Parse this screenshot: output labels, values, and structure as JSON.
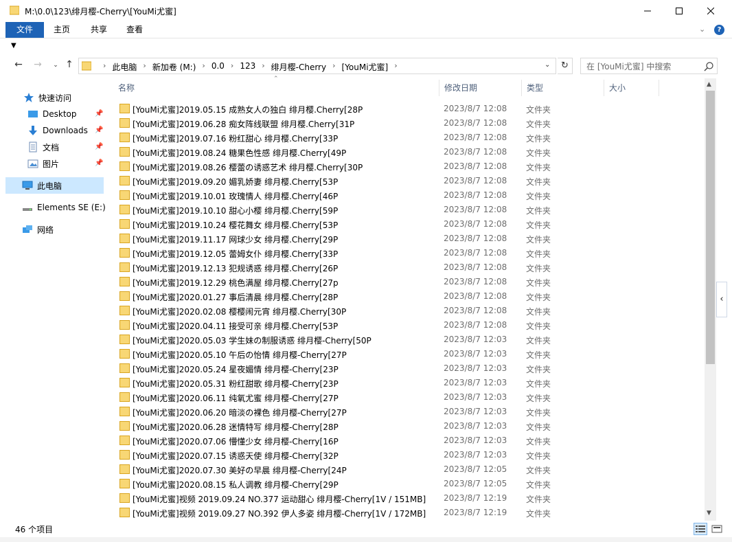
{
  "window": {
    "title": "M:\\0.0\\123\\绯月樱-Cherry\\[YouMi尤蜜]"
  },
  "ribbon": {
    "tabs": [
      "文件",
      "主页",
      "共享",
      "查看"
    ],
    "help_label": "?"
  },
  "address": {
    "crumbs": [
      "此电脑",
      "新加卷 (M:)",
      "0.0",
      "123",
      "绯月樱-Cherry",
      "[YouMi尤蜜]"
    ]
  },
  "search": {
    "placeholder": "在 [YouMi尤蜜] 中搜索"
  },
  "sidebar": {
    "items": [
      {
        "label": "快速访问",
        "icon": "star-icon"
      },
      {
        "label": "Desktop",
        "icon": "desktop-icon",
        "pinned": true
      },
      {
        "label": "Downloads",
        "icon": "download-icon",
        "pinned": true
      },
      {
        "label": "文档",
        "icon": "document-icon",
        "pinned": true
      },
      {
        "label": "图片",
        "icon": "picture-icon",
        "pinned": true
      },
      {
        "label": "此电脑",
        "icon": "computer-icon",
        "selected": true
      },
      {
        "label": "Elements SE (E:)",
        "icon": "drive-icon"
      },
      {
        "label": "网络",
        "icon": "network-icon"
      }
    ]
  },
  "columns": {
    "name": "名称",
    "date": "修改日期",
    "type": "类型",
    "size": "大小"
  },
  "files": [
    {
      "name": "[YouMi尤蜜]2019.05.15 成熟女人の独白 绯月樱.Cherry[28P",
      "date": "2023/8/7 12:08",
      "type": "文件夹"
    },
    {
      "name": "[YouMi尤蜜]2019.06.28 痴女阵线联盟 绯月樱.Cherry[31P",
      "date": "2023/8/7 12:08",
      "type": "文件夹"
    },
    {
      "name": "[YouMi尤蜜]2019.07.16 粉红甜心 绯月樱.Cherry[33P",
      "date": "2023/8/7 12:08",
      "type": "文件夹"
    },
    {
      "name": "[YouMi尤蜜]2019.08.24 糖果色性感 绯月樱.Cherry[49P",
      "date": "2023/8/7 12:08",
      "type": "文件夹"
    },
    {
      "name": "[YouMi尤蜜]2019.08.26 樱蕾の诱惑艺术 绯月樱.Cherry[30P",
      "date": "2023/8/7 12:08",
      "type": "文件夹"
    },
    {
      "name": "[YouMi尤蜜]2019.09.20 媚乳娇妻 绯月樱.Cherry[53P",
      "date": "2023/8/7 12:08",
      "type": "文件夹"
    },
    {
      "name": "[YouMi尤蜜]2019.10.01 玫瑰情人 绯月樱.Cherry[46P",
      "date": "2023/8/7 12:08",
      "type": "文件夹"
    },
    {
      "name": "[YouMi尤蜜]2019.10.10 甜心小樱 绯月樱.Cherry[59P",
      "date": "2023/8/7 12:08",
      "type": "文件夹"
    },
    {
      "name": "[YouMi尤蜜]2019.10.24 樱花舞女 绯月樱.Cherry[53P",
      "date": "2023/8/7 12:08",
      "type": "文件夹"
    },
    {
      "name": "[YouMi尤蜜]2019.11.17 网球少女 绯月樱.Cherry[29P",
      "date": "2023/8/7 12:08",
      "type": "文件夹"
    },
    {
      "name": "[YouMi尤蜜]2019.12.05 蕾姆女仆 绯月樱.Cherry[33P",
      "date": "2023/8/7 12:08",
      "type": "文件夹"
    },
    {
      "name": "[YouMi尤蜜]2019.12.13 犯规诱惑 绯月樱.Cherry[26P",
      "date": "2023/8/7 12:08",
      "type": "文件夹"
    },
    {
      "name": "[YouMi尤蜜]2019.12.29 桃色满屋 绯月樱.Cherry[27p",
      "date": "2023/8/7 12:08",
      "type": "文件夹"
    },
    {
      "name": "[YouMi尤蜜]2020.01.27 事后清晨 绯月樱.Cherry[28P",
      "date": "2023/8/7 12:08",
      "type": "文件夹"
    },
    {
      "name": "[YouMi尤蜜]2020.02.08 樱樱闹元宵 绯月樱.Cherry[30P",
      "date": "2023/8/7 12:08",
      "type": "文件夹"
    },
    {
      "name": "[YouMi尤蜜]2020.04.11 接受可亲 绯月樱.Cherry[53P",
      "date": "2023/8/7 12:08",
      "type": "文件夹"
    },
    {
      "name": "[YouMi尤蜜]2020.05.03 学生妹の制服诱惑 绯月樱-Cherry[50P",
      "date": "2023/8/7 12:03",
      "type": "文件夹"
    },
    {
      "name": "[YouMi尤蜜]2020.05.10 午后の怡情 绯月樱-Cherry[27P",
      "date": "2023/8/7 12:03",
      "type": "文件夹"
    },
    {
      "name": "[YouMi尤蜜]2020.05.24 星夜媚情 绯月樱-Cherry[23P",
      "date": "2023/8/7 12:03",
      "type": "文件夹"
    },
    {
      "name": "[YouMi尤蜜]2020.05.31 粉红甜歌 绯月樱-Cherry[23P",
      "date": "2023/8/7 12:03",
      "type": "文件夹"
    },
    {
      "name": "[YouMi尤蜜]2020.06.11 纯氧尤蜜 绯月樱-Cherry[27P",
      "date": "2023/8/7 12:03",
      "type": "文件夹"
    },
    {
      "name": "[YouMi尤蜜]2020.06.20 暗淡の裸色 绯月樱-Cherry[27P",
      "date": "2023/8/7 12:03",
      "type": "文件夹"
    },
    {
      "name": "[YouMi尤蜜]2020.06.28 迷情特写 绯月樱-Cherry[28P",
      "date": "2023/8/7 12:03",
      "type": "文件夹"
    },
    {
      "name": "[YouMi尤蜜]2020.07.06 懵懂少女 绯月樱-Cherry[16P",
      "date": "2023/8/7 12:03",
      "type": "文件夹"
    },
    {
      "name": "[YouMi尤蜜]2020.07.15 诱惑天使 绯月樱-Cherry[32P",
      "date": "2023/8/7 12:03",
      "type": "文件夹"
    },
    {
      "name": "[YouMi尤蜜]2020.07.30 美好の早晨 绯月樱-Cherry[24P",
      "date": "2023/8/7 12:05",
      "type": "文件夹"
    },
    {
      "name": "[YouMi尤蜜]2020.08.15 私人调教 绯月樱-Cherry[29P",
      "date": "2023/8/7 12:05",
      "type": "文件夹"
    },
    {
      "name": "[YouMi尤蜜]视频 2019.09.24 NO.377 运动甜心 绯月樱-Cherry[1V / 151MB]",
      "date": "2023/8/7 12:19",
      "type": "文件夹"
    },
    {
      "name": "[YouMi尤蜜]视频 2019.09.27 NO.392 伊人多姿 绯月樱-Cherry[1V / 172MB]",
      "date": "2023/8/7 12:19",
      "type": "文件夹"
    }
  ],
  "status": {
    "item_count": "46 个项目"
  },
  "colors": {
    "accent": "#1e63b6",
    "folder": "#f8d775",
    "selected": "#cce8ff"
  }
}
